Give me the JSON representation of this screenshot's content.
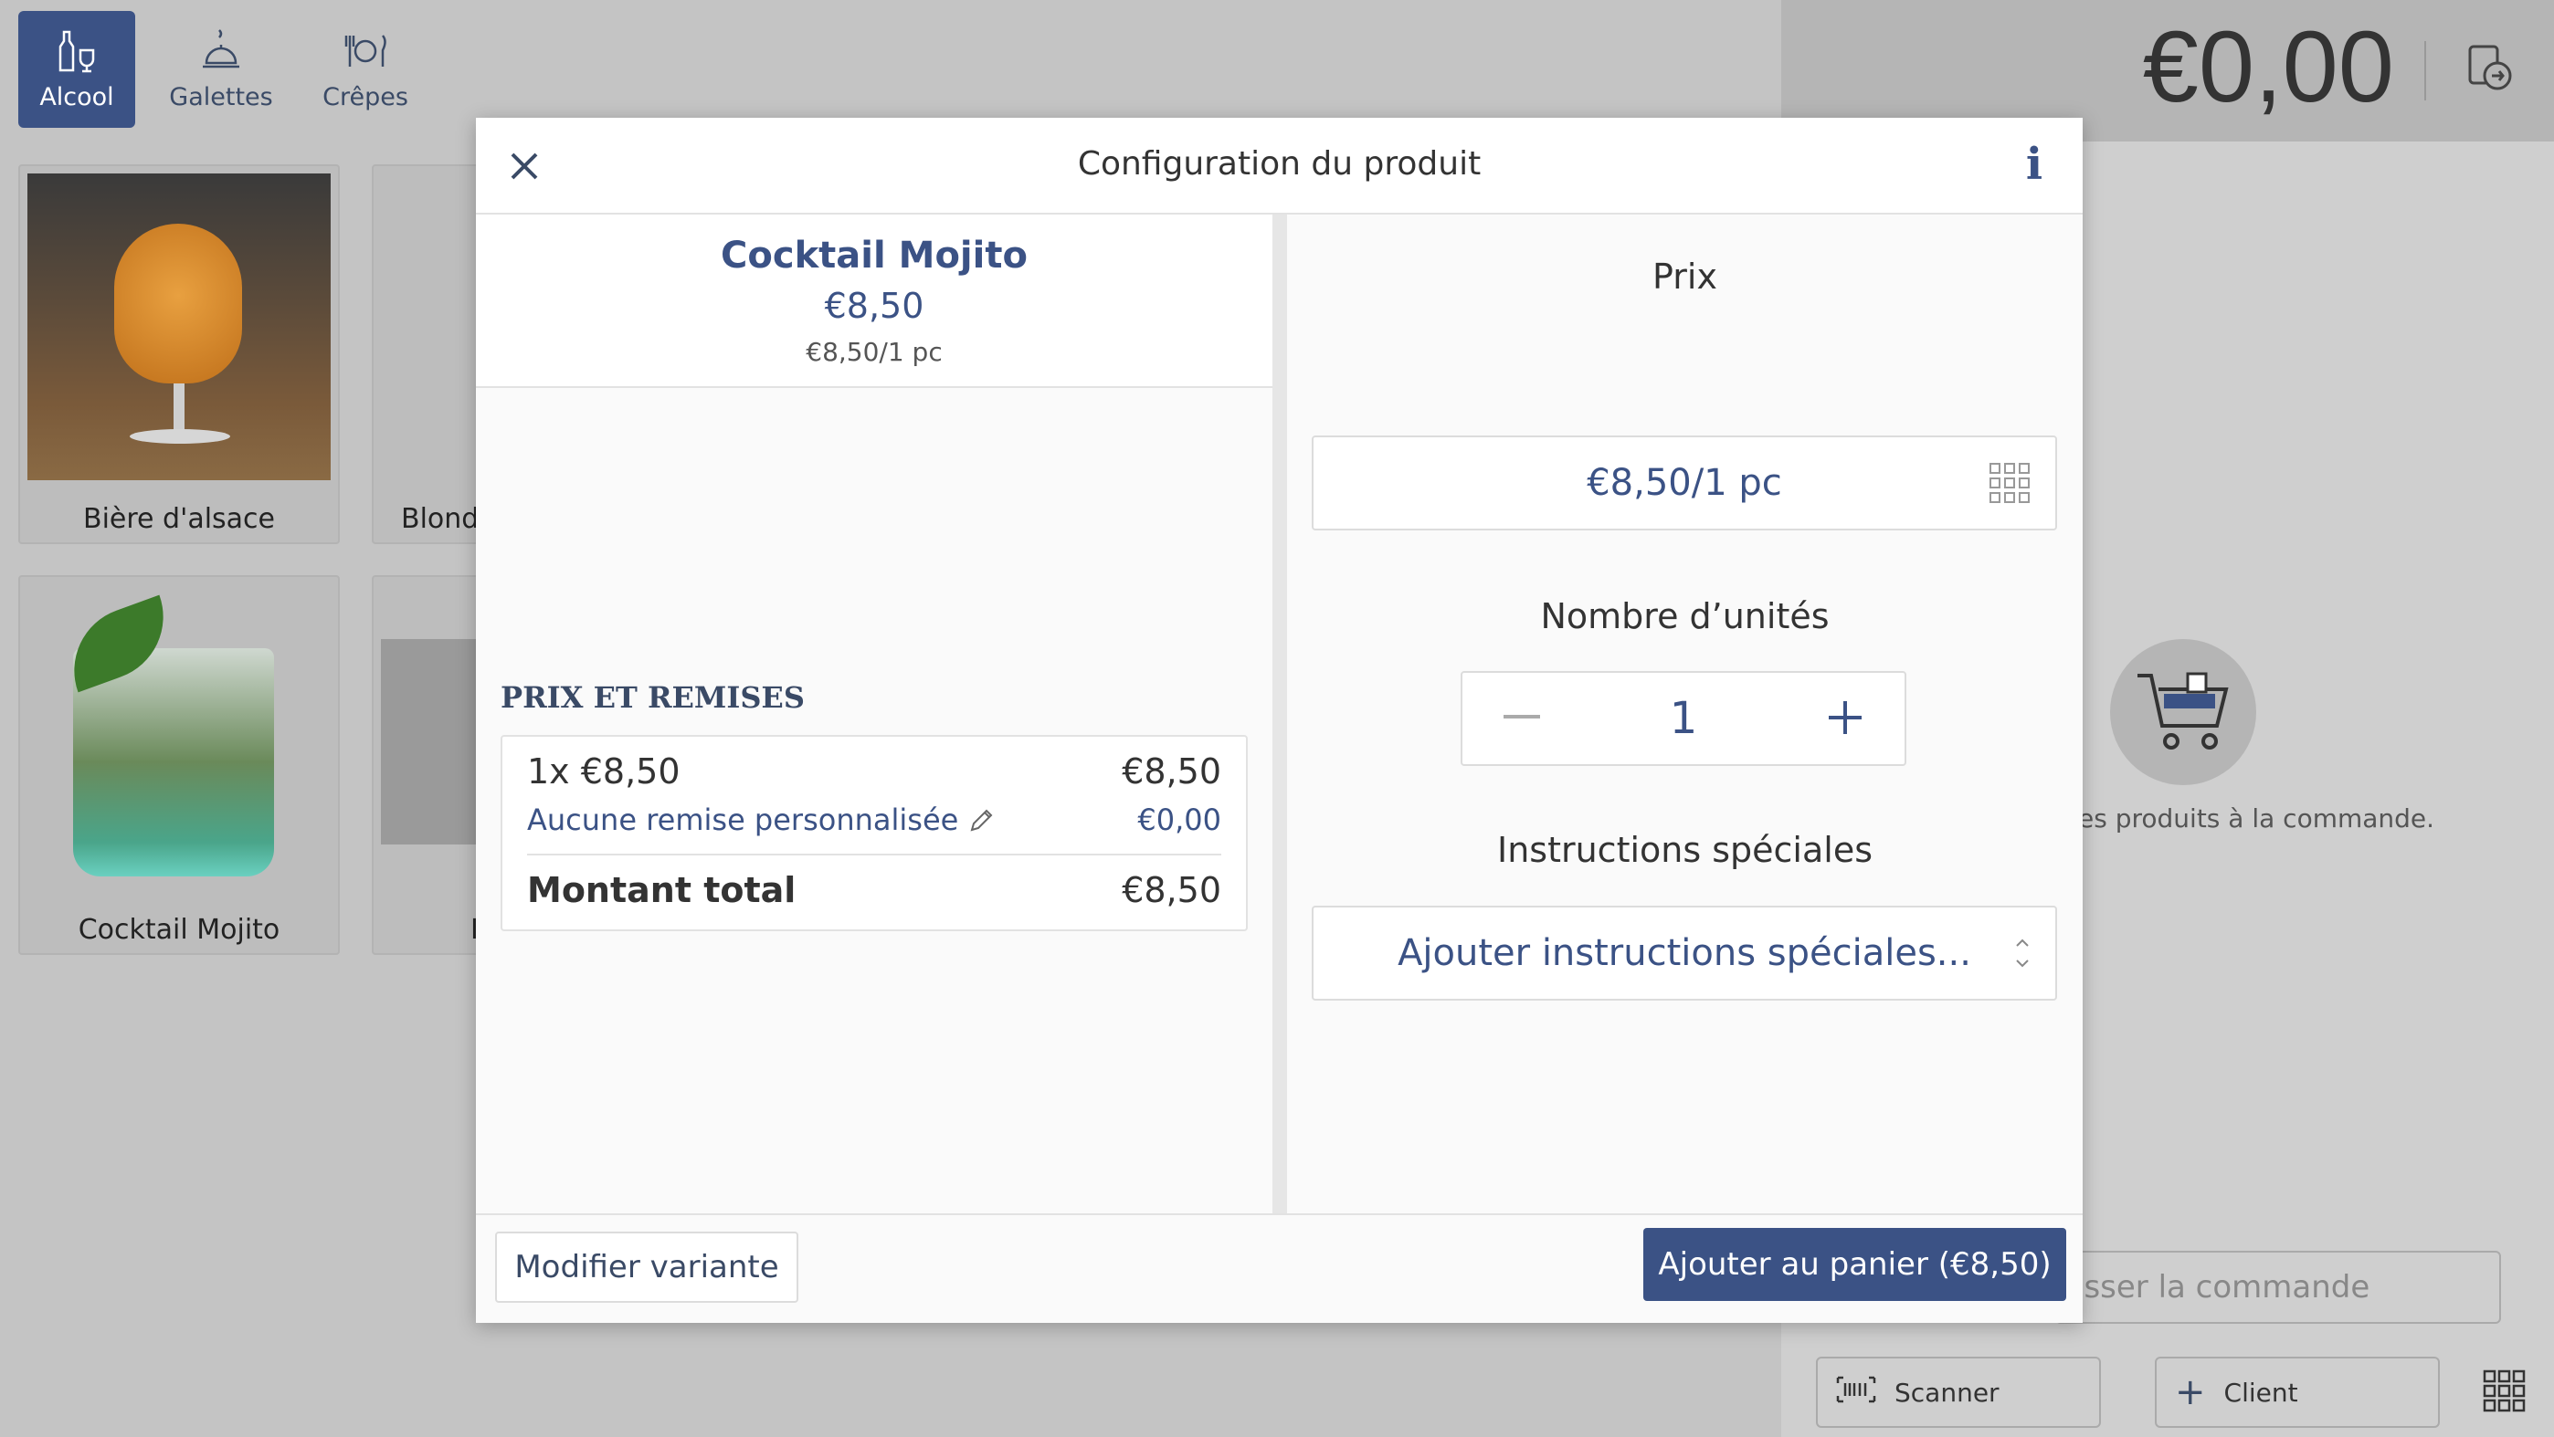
{
  "categories": [
    {
      "label": "Alcool",
      "icon": "bottle-glass-icon",
      "active": true
    },
    {
      "label": "Galettes",
      "icon": "cloche-icon",
      "active": false
    },
    {
      "label": "Crêpes",
      "icon": "plate-cutlery-icon",
      "active": false
    }
  ],
  "products": [
    {
      "label": "Bière d'alsace"
    },
    {
      "label": "Blonde"
    },
    {
      "label": "Cocktail Mojito"
    },
    {
      "label": "I"
    }
  ],
  "order": {
    "total": "€0,00",
    "empty_message": "es produits à la commande.",
    "finish_label": "isser la commande",
    "scanner_label": "Scanner",
    "client_label": "Client"
  },
  "modal": {
    "title": "Configuration du produit",
    "product": {
      "name": "Cocktail Mojito",
      "price": "€8,50",
      "unit_price": "€8,50/1 pc"
    },
    "pricing": {
      "section_title": "PRIX ET REMISES",
      "line_label": "1x €8,50",
      "line_amount": "€8,50",
      "discount_label": "Aucune remise personnalisée",
      "discount_amount": "€0,00",
      "total_label": "Montant total",
      "total_amount": "€8,50"
    },
    "price_field": {
      "label": "Prix",
      "value": "€8,50/1 pc"
    },
    "quantity": {
      "label": "Nombre d’unités",
      "value": "1"
    },
    "instructions": {
      "label": "Instructions spéciales",
      "placeholder": "Ajouter instructions spéciales..."
    },
    "footer": {
      "variant_label": "Modifier variante",
      "add_label": "Ajouter au panier (€8,50)"
    }
  },
  "colors": {
    "accent": "#3b5285",
    "background_dim": "#c4c4c4"
  }
}
